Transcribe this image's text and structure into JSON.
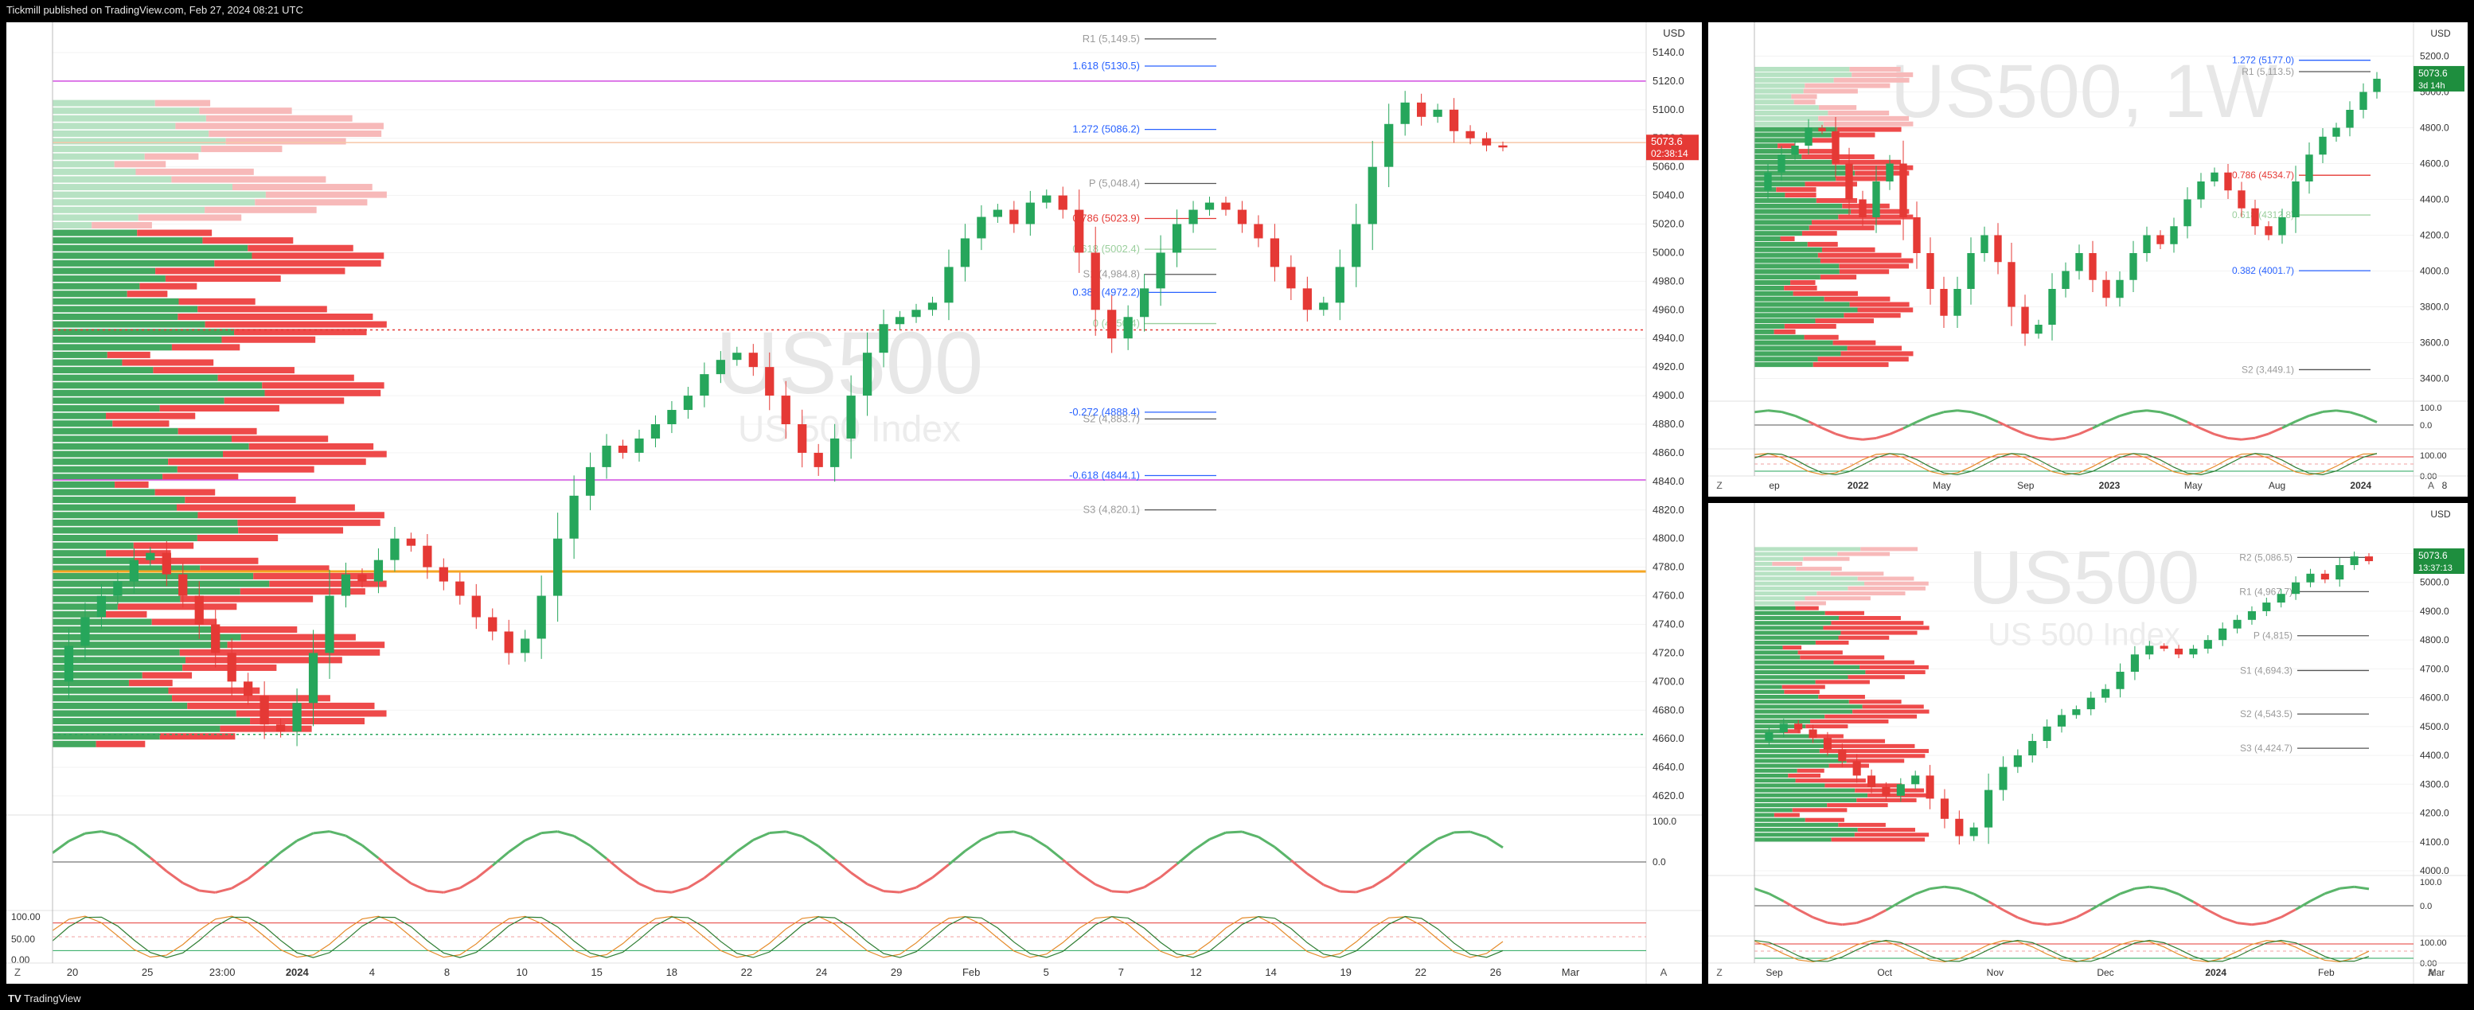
{
  "header": {
    "title": "Tickmill published on TradingView.com, Feb 27, 2024 08:21 UTC"
  },
  "footer": {
    "brand": "TradingView"
  },
  "colors": {
    "up": "#26a65b",
    "down": "#e53935",
    "price_tag": "#e53935",
    "price_tag_alt": "#1e8e3e",
    "fib_blue": "#2962ff",
    "fib_red": "#e53935",
    "magenta": "#d24ce0",
    "orange": "#f5a623"
  },
  "chart_data": [
    {
      "type": "line",
      "id": "main",
      "watermark": "US500",
      "watermark_sub": "US 500 Index",
      "currency": "USD",
      "ylim": [
        4610,
        5150
      ],
      "y_ticks": [
        "5140.0",
        "5120.0",
        "5100.0",
        "5080.0",
        "5060.0",
        "5040.0",
        "5020.0",
        "5000.0",
        "4980.0",
        "4960.0",
        "4940.0",
        "4920.0",
        "4900.0",
        "4880.0",
        "4860.0",
        "4840.0",
        "4820.0",
        "4800.0",
        "4780.0",
        "4760.0",
        "4740.0",
        "4720.0",
        "4700.0",
        "4680.0",
        "4660.0",
        "4640.0",
        "4620.0"
      ],
      "x_ticks": [
        "20",
        "25",
        "23:00",
        "2024",
        "4",
        "8",
        "10",
        "15",
        "18",
        "22",
        "24",
        "29",
        "Feb",
        "5",
        "7",
        "12",
        "14",
        "19",
        "22",
        "26",
        "Mar"
      ],
      "price": {
        "value": "5073.6",
        "countdown": "02:38:14"
      },
      "series": [
        {
          "name": "",
          "values": [
            4700,
            4725,
            4745,
            4760,
            4770,
            4785,
            4790,
            4775,
            4760,
            4740,
            4720,
            4700,
            4690,
            4670,
            4665,
            4685,
            4720,
            4760,
            4775,
            4770,
            4785,
            4800,
            4795,
            4780,
            4770,
            4760,
            4745,
            4735,
            4720,
            4730,
            4760,
            4800,
            4830,
            4850,
            4865,
            4860,
            4870,
            4880,
            4890,
            4900,
            4915,
            4925,
            4930,
            4920,
            4900,
            4880,
            4860,
            4850,
            4870,
            4900,
            4930,
            4950,
            4955,
            4960,
            4965,
            4990,
            5010,
            5025,
            5030,
            5020,
            5035,
            5040,
            5030,
            5000,
            4960,
            4940,
            4955,
            4975,
            5000,
            5020,
            5030,
            5035,
            5030,
            5020,
            5010,
            4990,
            4975,
            4960,
            4965,
            4990,
            5020,
            5060,
            5090,
            5105,
            5095,
            5100,
            5085,
            5080,
            5075,
            5073.6
          ]
        }
      ],
      "levels": [
        {
          "label": "R1 (5,149.5)",
          "value": 5149.5
        },
        {
          "label": "1.618 (5130.5)",
          "value": 5130.5
        },
        {
          "label": "1.272 (5086.2)",
          "value": 5086.2
        },
        {
          "label": "P (5,048.4)",
          "value": 5048.4
        },
        {
          "label": "0.786 (5023.9)",
          "value": 5023.9
        },
        {
          "label": "0.618 (5002.4)",
          "value": 5002.4
        },
        {
          "label": "S1 (4,984.8)",
          "value": 4984.8
        },
        {
          "label": "0.382 (4972.2)",
          "value": 4972.2
        },
        {
          "label": "0 (4950.4)",
          "value": 4950.4
        },
        {
          "label": "-0.272 (4888.4)",
          "value": 4888.4
        },
        {
          "label": "S2 (4,883.7)",
          "value": 4883.7
        },
        {
          "label": "-0.618 (4844.1)",
          "value": 4844.1
        },
        {
          "label": "S3 (4,820.1)",
          "value": 4820.1
        }
      ],
      "horizontal_lines": [
        {
          "value": 4777,
          "style": "solid",
          "color": "#f5a623"
        },
        {
          "value": 4946,
          "style": "dotted",
          "color": "#e53935"
        },
        {
          "value": 4663,
          "style": "dotted",
          "color": "#26a65b"
        },
        {
          "value": 5120,
          "style": "solid",
          "color": "#d24ce0"
        },
        {
          "value": 4841,
          "style": "solid",
          "color": "#d24ce0"
        },
        {
          "value": 5077,
          "style": "solid",
          "color": "#f6c7a8"
        }
      ],
      "oscillator1": {
        "label": "0.0",
        "top_label": "100.0"
      },
      "oscillator2": {
        "labels": [
          "100.00",
          "50.00",
          "0.00"
        ]
      }
    },
    {
      "type": "line",
      "id": "weekly",
      "watermark": "US500, 1W",
      "currency": "USD",
      "ylim": [
        3300,
        5300
      ],
      "y_ticks": [
        "5200.0",
        "5000.0",
        "4800.0",
        "4600.0",
        "4400.0",
        "4200.0",
        "4000.0",
        "3800.0",
        "3600.0",
        "3400.0"
      ],
      "x_ticks": [
        "ep",
        "2022",
        "May",
        "Sep",
        "2023",
        "May",
        "Aug",
        "2024",
        "8"
      ],
      "price": {
        "value": "5073.6",
        "countdown": "3d 14h"
      },
      "series": [
        {
          "name": "",
          "values": [
            4450,
            4550,
            4650,
            4700,
            4800,
            4780,
            4600,
            4400,
            4300,
            4500,
            4600,
            4300,
            4100,
            3900,
            3750,
            3900,
            4100,
            4200,
            4050,
            3800,
            3650,
            3700,
            3900,
            4000,
            4100,
            3950,
            3850,
            3950,
            4100,
            4200,
            4150,
            4250,
            4400,
            4500,
            4550,
            4450,
            4350,
            4250,
            4200,
            4300,
            4500,
            4650,
            4750,
            4800,
            4900,
            5000,
            5073.6
          ]
        }
      ],
      "levels": [
        {
          "label": "1.272 (5177.0)",
          "value": 5177.0
        },
        {
          "label": "R1 (5,113.5)",
          "value": 5113.5
        },
        {
          "label": "0.786 (4534.7)",
          "value": 4534.7
        },
        {
          "label": "0.618 (4312.8)",
          "value": 4312.8
        },
        {
          "label": "0.382 (4001.7)",
          "value": 4001.7
        },
        {
          "label": "S2 (3,449.1)",
          "value": 3449.1
        }
      ],
      "oscillator1": {
        "label": "0.0",
        "top_label": "100.0"
      },
      "oscillator2": {
        "labels": [
          "100.00",
          "0.00"
        ]
      }
    },
    {
      "type": "line",
      "id": "daily",
      "watermark": "US500",
      "watermark_sub": "US 500 Index",
      "currency": "USD",
      "ylim": [
        4000,
        5220
      ],
      "y_ticks": [
        "5100.0",
        "5000.0",
        "4900.0",
        "4800.0",
        "4700.0",
        "4600.0",
        "4500.0",
        "4400.0",
        "4300.0",
        "4200.0",
        "4100.0",
        "4000.0"
      ],
      "x_ticks": [
        "Sep",
        "Oct",
        "Nov",
        "Dec",
        "2024",
        "Feb",
        "Mar"
      ],
      "price": {
        "value": "5073.6",
        "countdown": "13:37:13"
      },
      "series": [
        {
          "name": "",
          "values": [
            4450,
            4480,
            4510,
            4490,
            4460,
            4420,
            4380,
            4330,
            4290,
            4260,
            4300,
            4330,
            4250,
            4180,
            4120,
            4150,
            4280,
            4360,
            4400,
            4450,
            4500,
            4540,
            4560,
            4600,
            4630,
            4690,
            4750,
            4780,
            4770,
            4750,
            4770,
            4800,
            4840,
            4870,
            4900,
            4930,
            4960,
            5000,
            5030,
            5010,
            5060,
            5090,
            5073.6
          ]
        }
      ],
      "levels": [
        {
          "label": "R2 (5,086.5)",
          "value": 5086.5
        },
        {
          "label": "R1 (4,967.7)",
          "value": 4967.7
        },
        {
          "label": "P (4,815)",
          "value": 4815
        },
        {
          "label": "S1 (4,694.3)",
          "value": 4694.3
        },
        {
          "label": "S2 (4,543.5)",
          "value": 4543.5
        },
        {
          "label": "S3 (4,424.7)",
          "value": 4424.7
        }
      ],
      "oscillator1": {
        "label": "0.0",
        "top_label": "100.0"
      },
      "oscillator2": {
        "labels": [
          "100.00",
          "0.00"
        ]
      }
    }
  ]
}
